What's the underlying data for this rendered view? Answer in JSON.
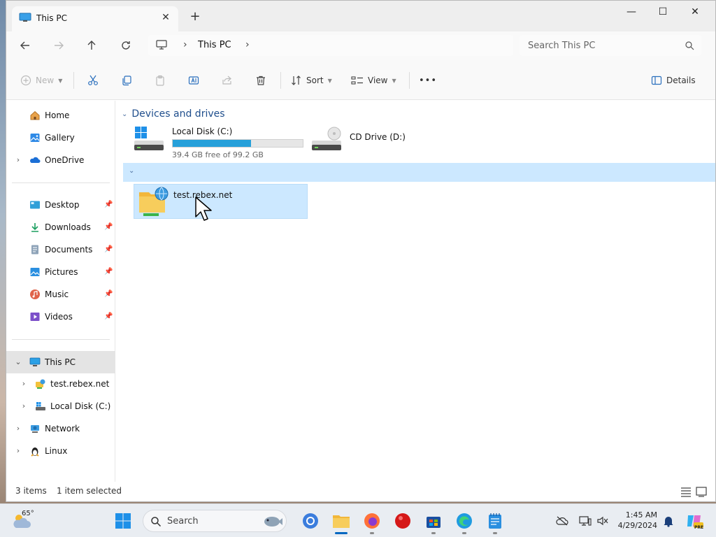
{
  "window": {
    "tab_title": "This PC",
    "close_tab_label": "✕",
    "new_tab_label": "+",
    "minimize_label": "—",
    "maximize_label": "☐",
    "close_label": "✕"
  },
  "nav": {
    "breadcrumb": [
      "This PC"
    ],
    "search_placeholder": "Search This PC"
  },
  "toolbar": {
    "new_label": "New",
    "sort_label": "Sort",
    "view_label": "View",
    "more_label": "•••",
    "details_label": "Details"
  },
  "sidebar": {
    "quick": [
      {
        "label": "Home",
        "icon": "home-icon"
      },
      {
        "label": "Gallery",
        "icon": "gallery-icon"
      },
      {
        "label": "OneDrive",
        "icon": "onedrive-icon",
        "expandable": true
      }
    ],
    "pinned": [
      {
        "label": "Desktop",
        "icon": "desktop-icon"
      },
      {
        "label": "Downloads",
        "icon": "downloads-icon"
      },
      {
        "label": "Documents",
        "icon": "documents-icon"
      },
      {
        "label": "Pictures",
        "icon": "pictures-icon"
      },
      {
        "label": "Music",
        "icon": "music-icon"
      },
      {
        "label": "Videos",
        "icon": "videos-icon"
      }
    ],
    "tree": [
      {
        "label": "This PC",
        "icon": "this-pc-icon",
        "expanded": true,
        "selected": true
      },
      {
        "label": "test.rebex.net",
        "icon": "network-location-icon"
      },
      {
        "label": "Local Disk (C:)",
        "icon": "local-disk-icon"
      },
      {
        "label": "Network",
        "icon": "network-icon"
      },
      {
        "label": "Linux",
        "icon": "linux-icon"
      }
    ]
  },
  "content": {
    "group_devices": "Devices and drives",
    "drives": [
      {
        "name": "Local Disk (C:)",
        "free_text": "39.4 GB free of 99.2 GB",
        "used_fraction": 0.603
      },
      {
        "name": "CD Drive (D:)"
      }
    ],
    "network_locations": [
      {
        "name": "test.rebex.net",
        "selected": true
      }
    ]
  },
  "status": {
    "item_count": "3 items",
    "selection": "1 item selected"
  },
  "taskbar": {
    "weather_temp": "65°",
    "search_label": "Search",
    "time": "1:45 AM",
    "date": "4/29/2024",
    "copilot_badge": "PRE"
  },
  "colors": {
    "accent": "#0067c0",
    "selection": "#cce8ff",
    "drive_bar": "#26a0da",
    "group_header": "#1f4e8c"
  }
}
